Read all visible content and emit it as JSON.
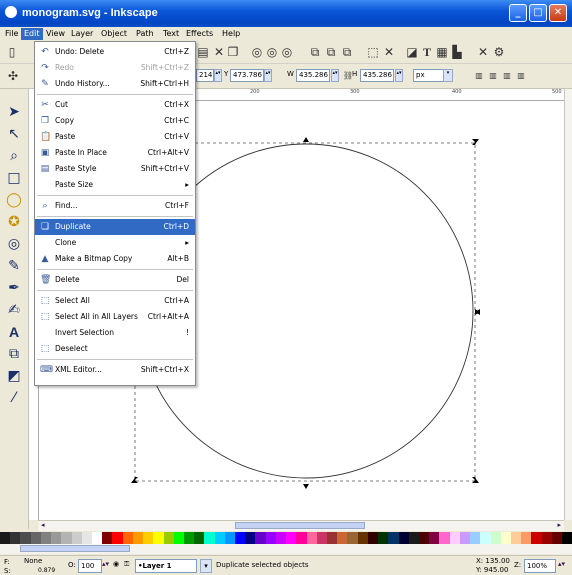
{
  "window": {
    "title": "monogram.svg - Inkscape",
    "controls": {
      "minimize": "_",
      "maximize": "□",
      "close": "✕"
    }
  },
  "menubar": [
    "File",
    "Edit",
    "View",
    "Layer",
    "Object",
    "Path",
    "Text",
    "Effects",
    "Help"
  ],
  "toolbar2": {
    "x_value": "214",
    "y_label": "Y",
    "y_value": "473.786",
    "w_label": "W",
    "w_value": "435.286",
    "h_label": "H",
    "h_value": "435.286",
    "unit": "px"
  },
  "ruler": {
    "marks": [
      "200",
      "300",
      "400",
      "500"
    ]
  },
  "edit_menu": [
    {
      "icon": "undo-icon",
      "glyph": "↶",
      "label": "Undo: Delete",
      "shortcut": "Ctrl+Z",
      "disabled": false
    },
    {
      "icon": "redo-icon",
      "glyph": "↷",
      "label": "Redo",
      "shortcut": "Shift+Ctrl+Z",
      "disabled": true
    },
    {
      "icon": "undo-history-icon",
      "glyph": "✎",
      "label": "Undo History...",
      "shortcut": "Shift+Ctrl+H",
      "disabled": false
    },
    {
      "sep": true
    },
    {
      "icon": "cut-icon",
      "glyph": "✂",
      "label": "Cut",
      "shortcut": "Ctrl+X",
      "disabled": false
    },
    {
      "icon": "copy-icon",
      "glyph": "❐",
      "label": "Copy",
      "shortcut": "Ctrl+C",
      "disabled": false
    },
    {
      "icon": "paste-icon",
      "glyph": "📋",
      "label": "Paste",
      "shortcut": "Ctrl+V",
      "disabled": false
    },
    {
      "icon": "paste-in-place-icon",
      "glyph": "▣",
      "label": "Paste In Place",
      "shortcut": "Ctrl+Alt+V",
      "disabled": false
    },
    {
      "icon": "paste-style-icon",
      "glyph": "▤",
      "label": "Paste Style",
      "shortcut": "Shift+Ctrl+V",
      "disabled": false
    },
    {
      "icon": "",
      "glyph": "",
      "label": "Paste Size",
      "shortcut": "▸",
      "disabled": false
    },
    {
      "sep": true
    },
    {
      "icon": "find-icon",
      "glyph": "⌕",
      "label": "Find...",
      "shortcut": "Ctrl+F",
      "disabled": false
    },
    {
      "sep": true
    },
    {
      "icon": "duplicate-icon",
      "glyph": "❏",
      "label": "Duplicate",
      "shortcut": "Ctrl+D",
      "disabled": false,
      "highlight": true
    },
    {
      "icon": "",
      "glyph": "",
      "label": "Clone",
      "shortcut": "▸",
      "disabled": false
    },
    {
      "icon": "bitmap-copy-icon",
      "glyph": "▲",
      "label": "Make a Bitmap Copy",
      "shortcut": "Alt+B",
      "disabled": false
    },
    {
      "sep": true
    },
    {
      "icon": "delete-icon",
      "glyph": "🗑",
      "label": "Delete",
      "shortcut": "Del",
      "disabled": false
    },
    {
      "sep": true
    },
    {
      "icon": "select-all-icon",
      "glyph": "⬚",
      "label": "Select All",
      "shortcut": "Ctrl+A",
      "disabled": false
    },
    {
      "icon": "select-all-layers-icon",
      "glyph": "⬚",
      "label": "Select All in All Layers",
      "shortcut": "Ctrl+Alt+A",
      "disabled": false
    },
    {
      "icon": "",
      "glyph": "",
      "label": "Invert Selection",
      "shortcut": "!",
      "disabled": false
    },
    {
      "icon": "deselect-icon",
      "glyph": "⬚",
      "label": "Deselect",
      "shortcut": "",
      "disabled": false
    },
    {
      "sep": true
    },
    {
      "icon": "xml-editor-icon",
      "glyph": "⌨",
      "label": "XML Editor...",
      "shortcut": "Shift+Ctrl+X",
      "disabled": false
    }
  ],
  "status": {
    "fill_label": "F:",
    "fill_value": "None",
    "stroke_label": "S:",
    "stroke_value": "0.879",
    "opacity_label": "O:",
    "opacity_value": "100",
    "layer": "•Layer 1",
    "message": "Duplicate selected objects",
    "x_coord": "X: 135.00",
    "y_coord": "Y: 945.00",
    "zoom_label": "Z:",
    "zoom_value": "100%"
  },
  "palette": [
    "#1a1a1a",
    "#333333",
    "#4d4d4d",
    "#666666",
    "#808080",
    "#999999",
    "#b3b3b3",
    "#cccccc",
    "#e6e6e6",
    "#ffffff",
    "#800000",
    "#ff0000",
    "#ff6600",
    "#ff9900",
    "#ffcc00",
    "#ffff00",
    "#99cc00",
    "#00ff00",
    "#009900",
    "#006600",
    "#00ffcc",
    "#00ccff",
    "#0099ff",
    "#0000ff",
    "#000080",
    "#6600cc",
    "#9900ff",
    "#cc00ff",
    "#ff00ff",
    "#ff0099",
    "#ff6699",
    "#cc3366",
    "#993333",
    "#cc6633",
    "#996633",
    "#663300",
    "#330000",
    "#003300",
    "#003366",
    "#000033",
    "#1a1a1a",
    "#4d0000",
    "#800040",
    "#ff66cc",
    "#ffccff",
    "#cc99ff",
    "#99ccff",
    "#ccffff",
    "#ccffcc",
    "#ffffcc",
    "#ffcc99",
    "#ff9966",
    "#cc0000",
    "#990000",
    "#660000",
    "#000000"
  ]
}
